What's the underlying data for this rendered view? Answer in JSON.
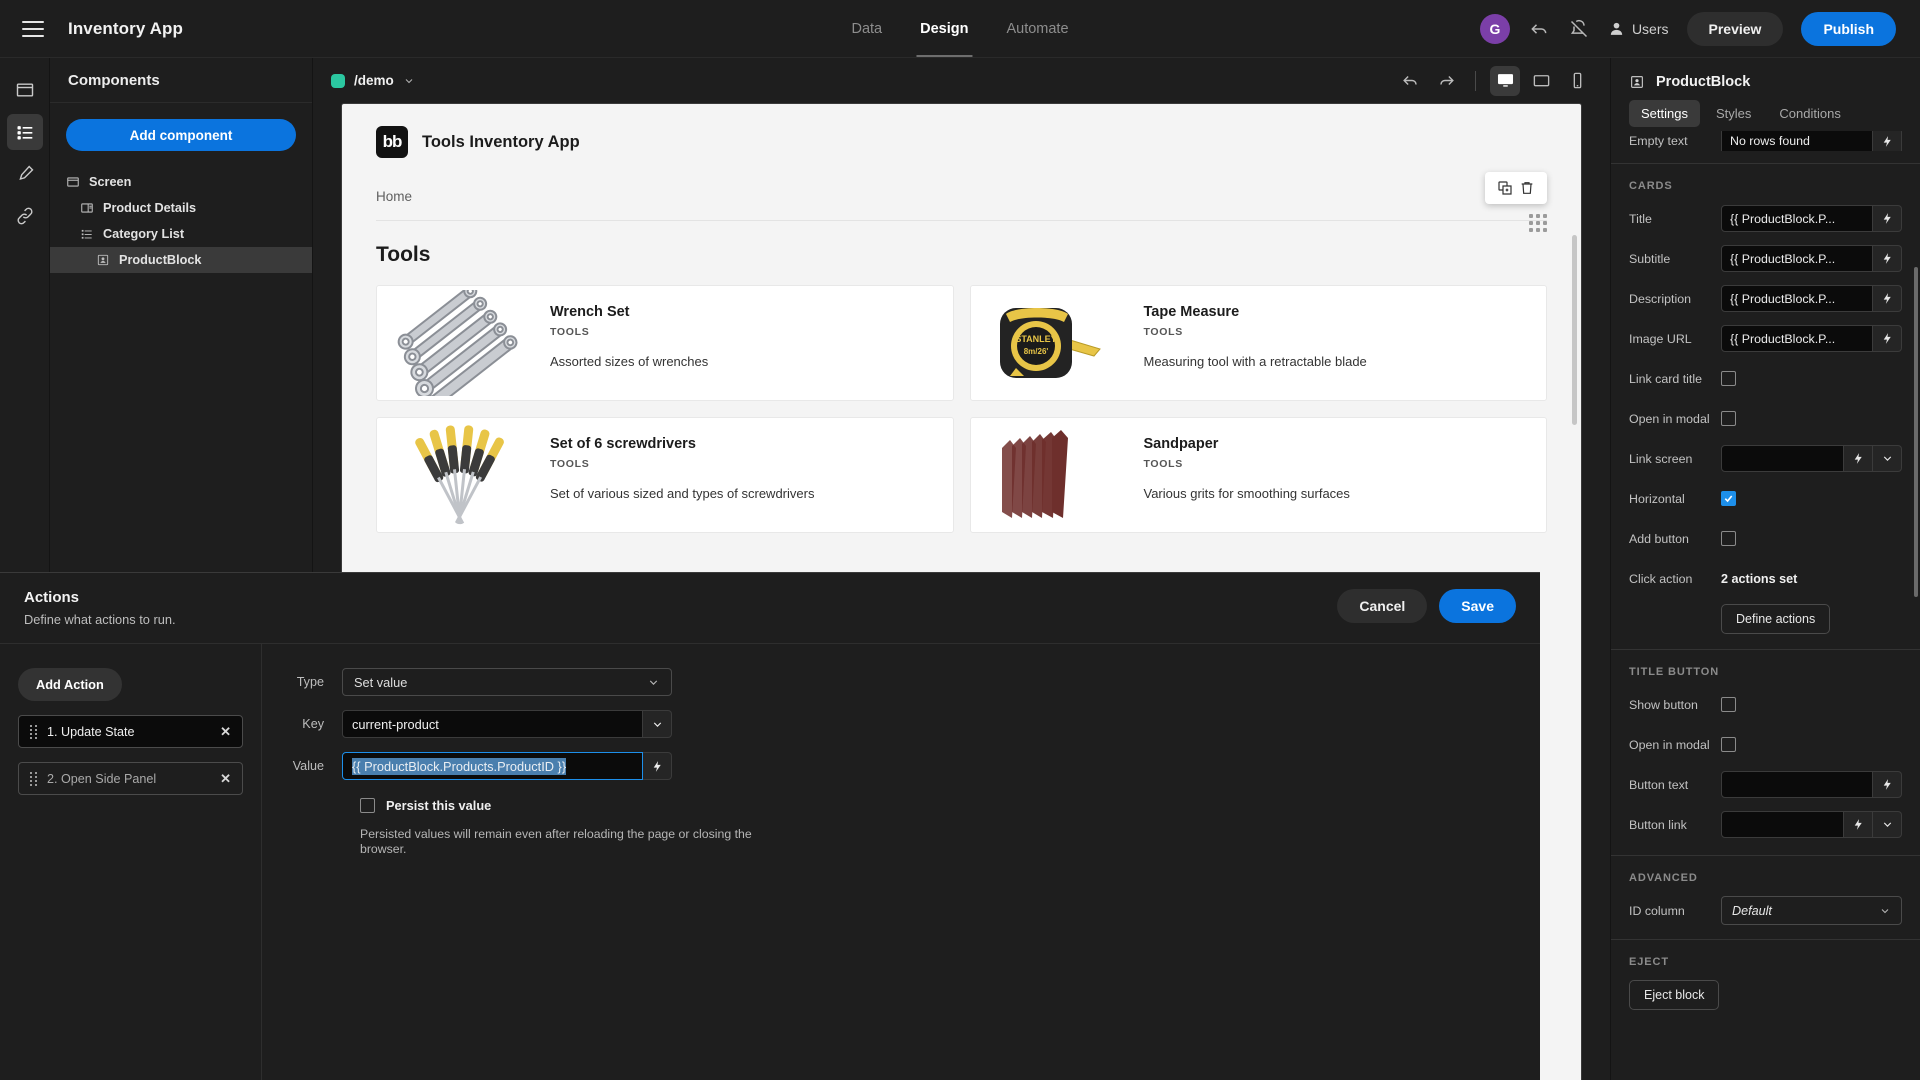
{
  "topbar": {
    "menu_icon": "hamburger-icon",
    "app_name": "Inventory App",
    "tabs": [
      {
        "label": "Data",
        "active": false
      },
      {
        "label": "Design",
        "active": true
      },
      {
        "label": "Automate",
        "active": false
      }
    ],
    "avatar_initial": "G",
    "undo_icon": "undo-icon",
    "notifications_icon": "bell-off-icon",
    "users_label": "Users",
    "preview_label": "Preview",
    "publish_label": "Publish"
  },
  "rail": {
    "items": [
      {
        "name": "screen-icon",
        "active": false
      },
      {
        "name": "components-list-icon",
        "active": true
      },
      {
        "name": "theme-brush-icon",
        "active": false
      },
      {
        "name": "links-chain-icon",
        "active": false
      }
    ]
  },
  "components_panel": {
    "header": "Components",
    "add_button": "Add component",
    "tree": [
      {
        "label": "Screen",
        "icon": "screen-icon",
        "depth": 0,
        "selected": false
      },
      {
        "label": "Product Details",
        "icon": "sidepanel-icon",
        "depth": 1,
        "selected": false
      },
      {
        "label": "Category List",
        "icon": "list-icon",
        "depth": 1,
        "selected": false
      },
      {
        "label": "ProductBlock",
        "icon": "card-block-icon",
        "depth": 2,
        "selected": true
      }
    ]
  },
  "canvas_bar": {
    "screen_name": "/demo",
    "screen_dot_color": "#2bc7a0",
    "undo_icon": "undo-icon",
    "redo_icon": "redo-icon",
    "devices": [
      {
        "name": "desktop-icon",
        "active": true
      },
      {
        "name": "tablet-icon",
        "active": false
      },
      {
        "name": "mobile-icon",
        "active": false
      }
    ]
  },
  "preview": {
    "brand_logo_text": "bb",
    "brand_title": "Tools Inventory App",
    "nav_links": [
      "Home"
    ],
    "block_tools": [
      "duplicate-icon",
      "delete-icon"
    ],
    "drag_handle_icon": "drag-dots-icon",
    "section_title": "Tools",
    "cards": [
      {
        "title": "Wrench Set",
        "subtitle": "TOOLS",
        "description": "Assorted sizes of wrenches",
        "image": "wrench-set-image"
      },
      {
        "title": "Tape Measure",
        "subtitle": "TOOLS",
        "description": "Measuring tool with a retractable blade",
        "image": "tape-measure-image"
      },
      {
        "title": "Set of 6 screwdrivers",
        "subtitle": "TOOLS",
        "description": "Set of various sized and types of screwdrivers",
        "image": "screwdrivers-image"
      },
      {
        "title": "Sandpaper",
        "subtitle": "TOOLS",
        "description": "Various grits for smoothing surfaces",
        "image": "sandpaper-image"
      }
    ]
  },
  "settings": {
    "title": "ProductBlock",
    "title_icon": "card-block-icon",
    "tabs": [
      {
        "label": "Settings",
        "active": true
      },
      {
        "label": "Styles",
        "active": false
      },
      {
        "label": "Conditions",
        "active": false
      }
    ],
    "empty_text_label": "Empty text",
    "empty_text_value": "No rows found",
    "cards_group": "CARDS",
    "fields": {
      "title_label": "Title",
      "title_value": "{{ ProductBlock.P...",
      "subtitle_label": "Subtitle",
      "subtitle_value": "{{ ProductBlock.P...",
      "description_label": "Description",
      "description_value": "{{ ProductBlock.P...",
      "image_url_label": "Image URL",
      "image_url_value": "{{ ProductBlock.P...",
      "link_card_title_label": "Link card title",
      "open_in_modal_label": "Open in modal",
      "link_screen_label": "Link screen",
      "link_screen_value": "",
      "horizontal_label": "Horizontal",
      "add_button_label": "Add button",
      "click_action_label": "Click action",
      "click_action_value": "2 actions set",
      "define_actions_button": "Define actions"
    },
    "title_button_group": "TITLE BUTTON",
    "title_button": {
      "show_button_label": "Show button",
      "open_in_modal_label": "Open in modal",
      "button_text_label": "Button text",
      "button_text_value": "",
      "button_link_label": "Button link",
      "button_link_value": ""
    },
    "advanced_group": "ADVANCED",
    "advanced": {
      "id_column_label": "ID column",
      "id_column_value": "Default"
    },
    "eject_group": "EJECT",
    "eject_button": "Eject block"
  },
  "actions_drawer": {
    "title": "Actions",
    "subtitle": "Define what actions to run.",
    "cancel_label": "Cancel",
    "save_label": "Save",
    "add_action_label": "Add Action",
    "actions": [
      {
        "label": "1. Update State",
        "selected": true
      },
      {
        "label": "2. Open Side Panel",
        "selected": false
      }
    ],
    "form": {
      "type_label": "Type",
      "type_value": "Set value",
      "key_label": "Key",
      "key_value": "current-product",
      "value_label": "Value",
      "value_value": "{{ ProductBlock.Products.ProductID }}",
      "persist_label": "Persist this value",
      "persist_checked": false,
      "hint": "Persisted values will remain even after reloading the page or closing the browser."
    }
  },
  "colors": {
    "accent": "#0b74de",
    "checkbox_checked": "#1d8fea",
    "avatar": "#7b3fa8",
    "screen_dot": "#2bc7a0",
    "selection": "#4a7fae"
  }
}
